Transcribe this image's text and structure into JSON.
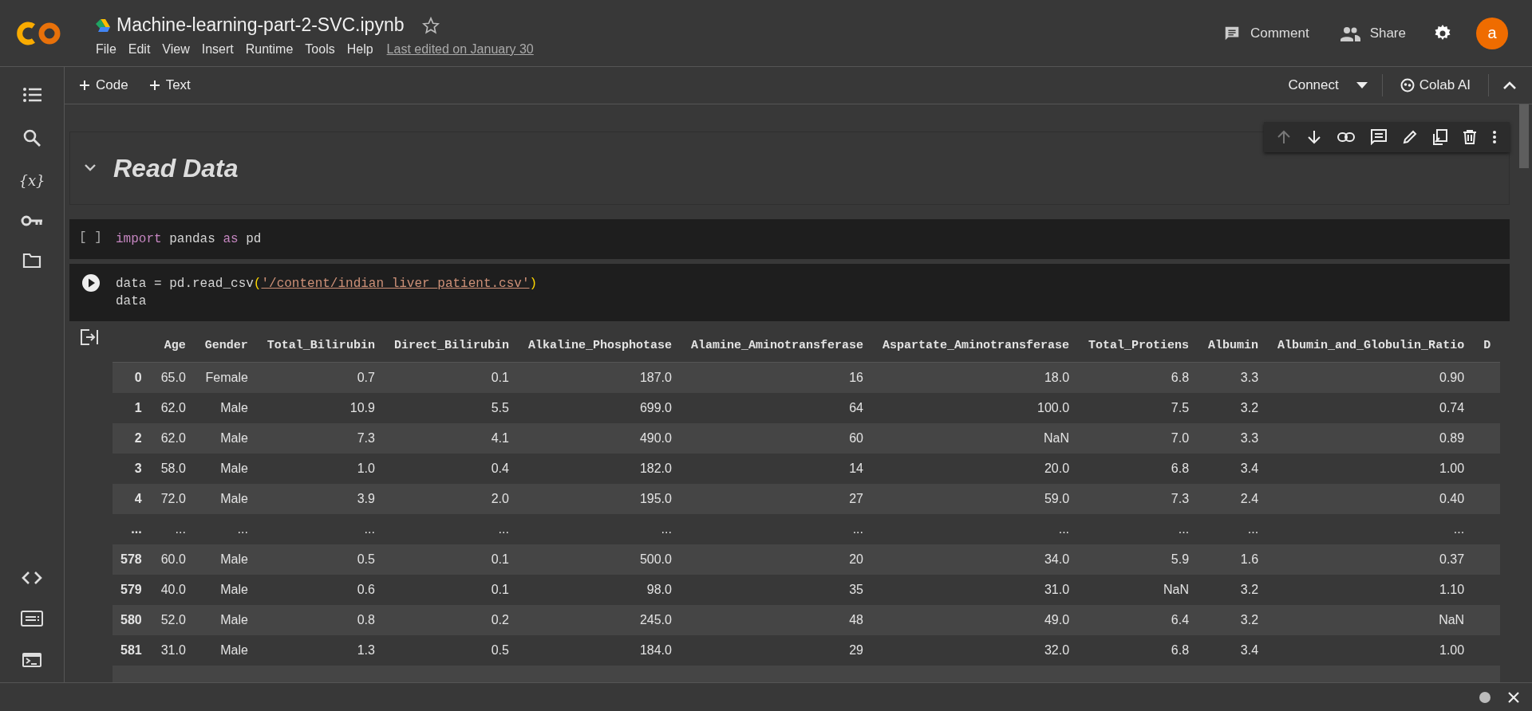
{
  "header": {
    "title": "Machine-learning-part-2-SVC.ipynb",
    "starred": false,
    "menu": [
      "File",
      "Edit",
      "View",
      "Insert",
      "Runtime",
      "Tools",
      "Help"
    ],
    "last_edited": "Last edited on January 30",
    "comment": "Comment",
    "share": "Share",
    "avatar": "a"
  },
  "toolbar": {
    "add_buttons": [
      "Code",
      "Text"
    ],
    "connect": "Connect",
    "colab_ai": "Colab AI"
  },
  "sidebar": {
    "top": [
      {
        "kind": "toc"
      },
      {
        "kind": "search"
      },
      {
        "kind": "variables",
        "glyph": "{x}"
      },
      {
        "kind": "secrets"
      },
      {
        "kind": "files"
      }
    ],
    "bottom": [
      {
        "kind": "snippets"
      },
      {
        "kind": "palette"
      },
      {
        "kind": "terminal"
      }
    ]
  },
  "cell_toolbar": [
    {
      "kind": "up",
      "disabled": true
    },
    {
      "kind": "down",
      "disabled": false
    },
    {
      "kind": "link",
      "disabled": false
    },
    {
      "kind": "comment",
      "disabled": false
    },
    {
      "kind": "edit",
      "disabled": false
    },
    {
      "kind": "mirror",
      "disabled": false
    },
    {
      "kind": "delete",
      "disabled": false
    },
    {
      "kind": "more",
      "disabled": false
    }
  ],
  "cells": [
    {
      "kind": "text",
      "heading": "Read Data",
      "expanded": true
    },
    {
      "kind": "code",
      "prompt": "[ ]",
      "lines": [
        [
          {
            "kind": "keyword",
            "text": "import"
          },
          {
            "kind": "plain",
            "text": " pandas "
          },
          {
            "kind": "keyword",
            "text": "as"
          },
          {
            "kind": "plain",
            "text": " pd"
          }
        ]
      ]
    },
    {
      "kind": "code",
      "lines": [
        [
          {
            "kind": "plain",
            "text": "data = pd.read_csv"
          },
          {
            "kind": "paren",
            "text": "("
          },
          {
            "kind": "string",
            "text": "'/content/indian_liver_patient.csv'"
          },
          {
            "kind": "paren",
            "text": ")"
          }
        ],
        [
          {
            "kind": "plain",
            "text": "data"
          }
        ]
      ],
      "output": {
        "columns": [
          "Age",
          "Gender",
          "Total_Bilirubin",
          "Direct_Bilirubin",
          "Alkaline_Phosphotase",
          "Alamine_Aminotransferase",
          "Aspartate_Aminotransferase",
          "Total_Protiens",
          "Albumin",
          "Albumin_and_Globulin_Ratio",
          "D"
        ],
        "rows": [
          {
            "index": "0",
            "cells": [
              "65.0",
              "Female",
              "0.7",
              "0.1",
              "187.0",
              "16",
              "18.0",
              "6.8",
              "3.3",
              "0.90"
            ]
          },
          {
            "index": "1",
            "cells": [
              "62.0",
              "Male",
              "10.9",
              "5.5",
              "699.0",
              "64",
              "100.0",
              "7.5",
              "3.2",
              "0.74"
            ]
          },
          {
            "index": "2",
            "cells": [
              "62.0",
              "Male",
              "7.3",
              "4.1",
              "490.0",
              "60",
              "NaN",
              "7.0",
              "3.3",
              "0.89"
            ]
          },
          {
            "index": "3",
            "cells": [
              "58.0",
              "Male",
              "1.0",
              "0.4",
              "182.0",
              "14",
              "20.0",
              "6.8",
              "3.4",
              "1.00"
            ]
          },
          {
            "index": "4",
            "cells": [
              "72.0",
              "Male",
              "3.9",
              "2.0",
              "195.0",
              "27",
              "59.0",
              "7.3",
              "2.4",
              "0.40"
            ]
          },
          {
            "index": "...",
            "cells": [
              "...",
              "...",
              "...",
              "...",
              "...",
              "...",
              "...",
              "...",
              "...",
              "..."
            ]
          },
          {
            "index": "578",
            "cells": [
              "60.0",
              "Male",
              "0.5",
              "0.1",
              "500.0",
              "20",
              "34.0",
              "5.9",
              "1.6",
              "0.37"
            ]
          },
          {
            "index": "579",
            "cells": [
              "40.0",
              "Male",
              "0.6",
              "0.1",
              "98.0",
              "35",
              "31.0",
              "NaN",
              "3.2",
              "1.10"
            ]
          },
          {
            "index": "580",
            "cells": [
              "52.0",
              "Male",
              "0.8",
              "0.2",
              "245.0",
              "48",
              "49.0",
              "6.4",
              "3.2",
              "NaN"
            ]
          },
          {
            "index": "581",
            "cells": [
              "31.0",
              "Male",
              "1.3",
              "0.5",
              "184.0",
              "29",
              "32.0",
              "6.8",
              "3.4",
              "1.00"
            ]
          }
        ]
      }
    }
  ]
}
